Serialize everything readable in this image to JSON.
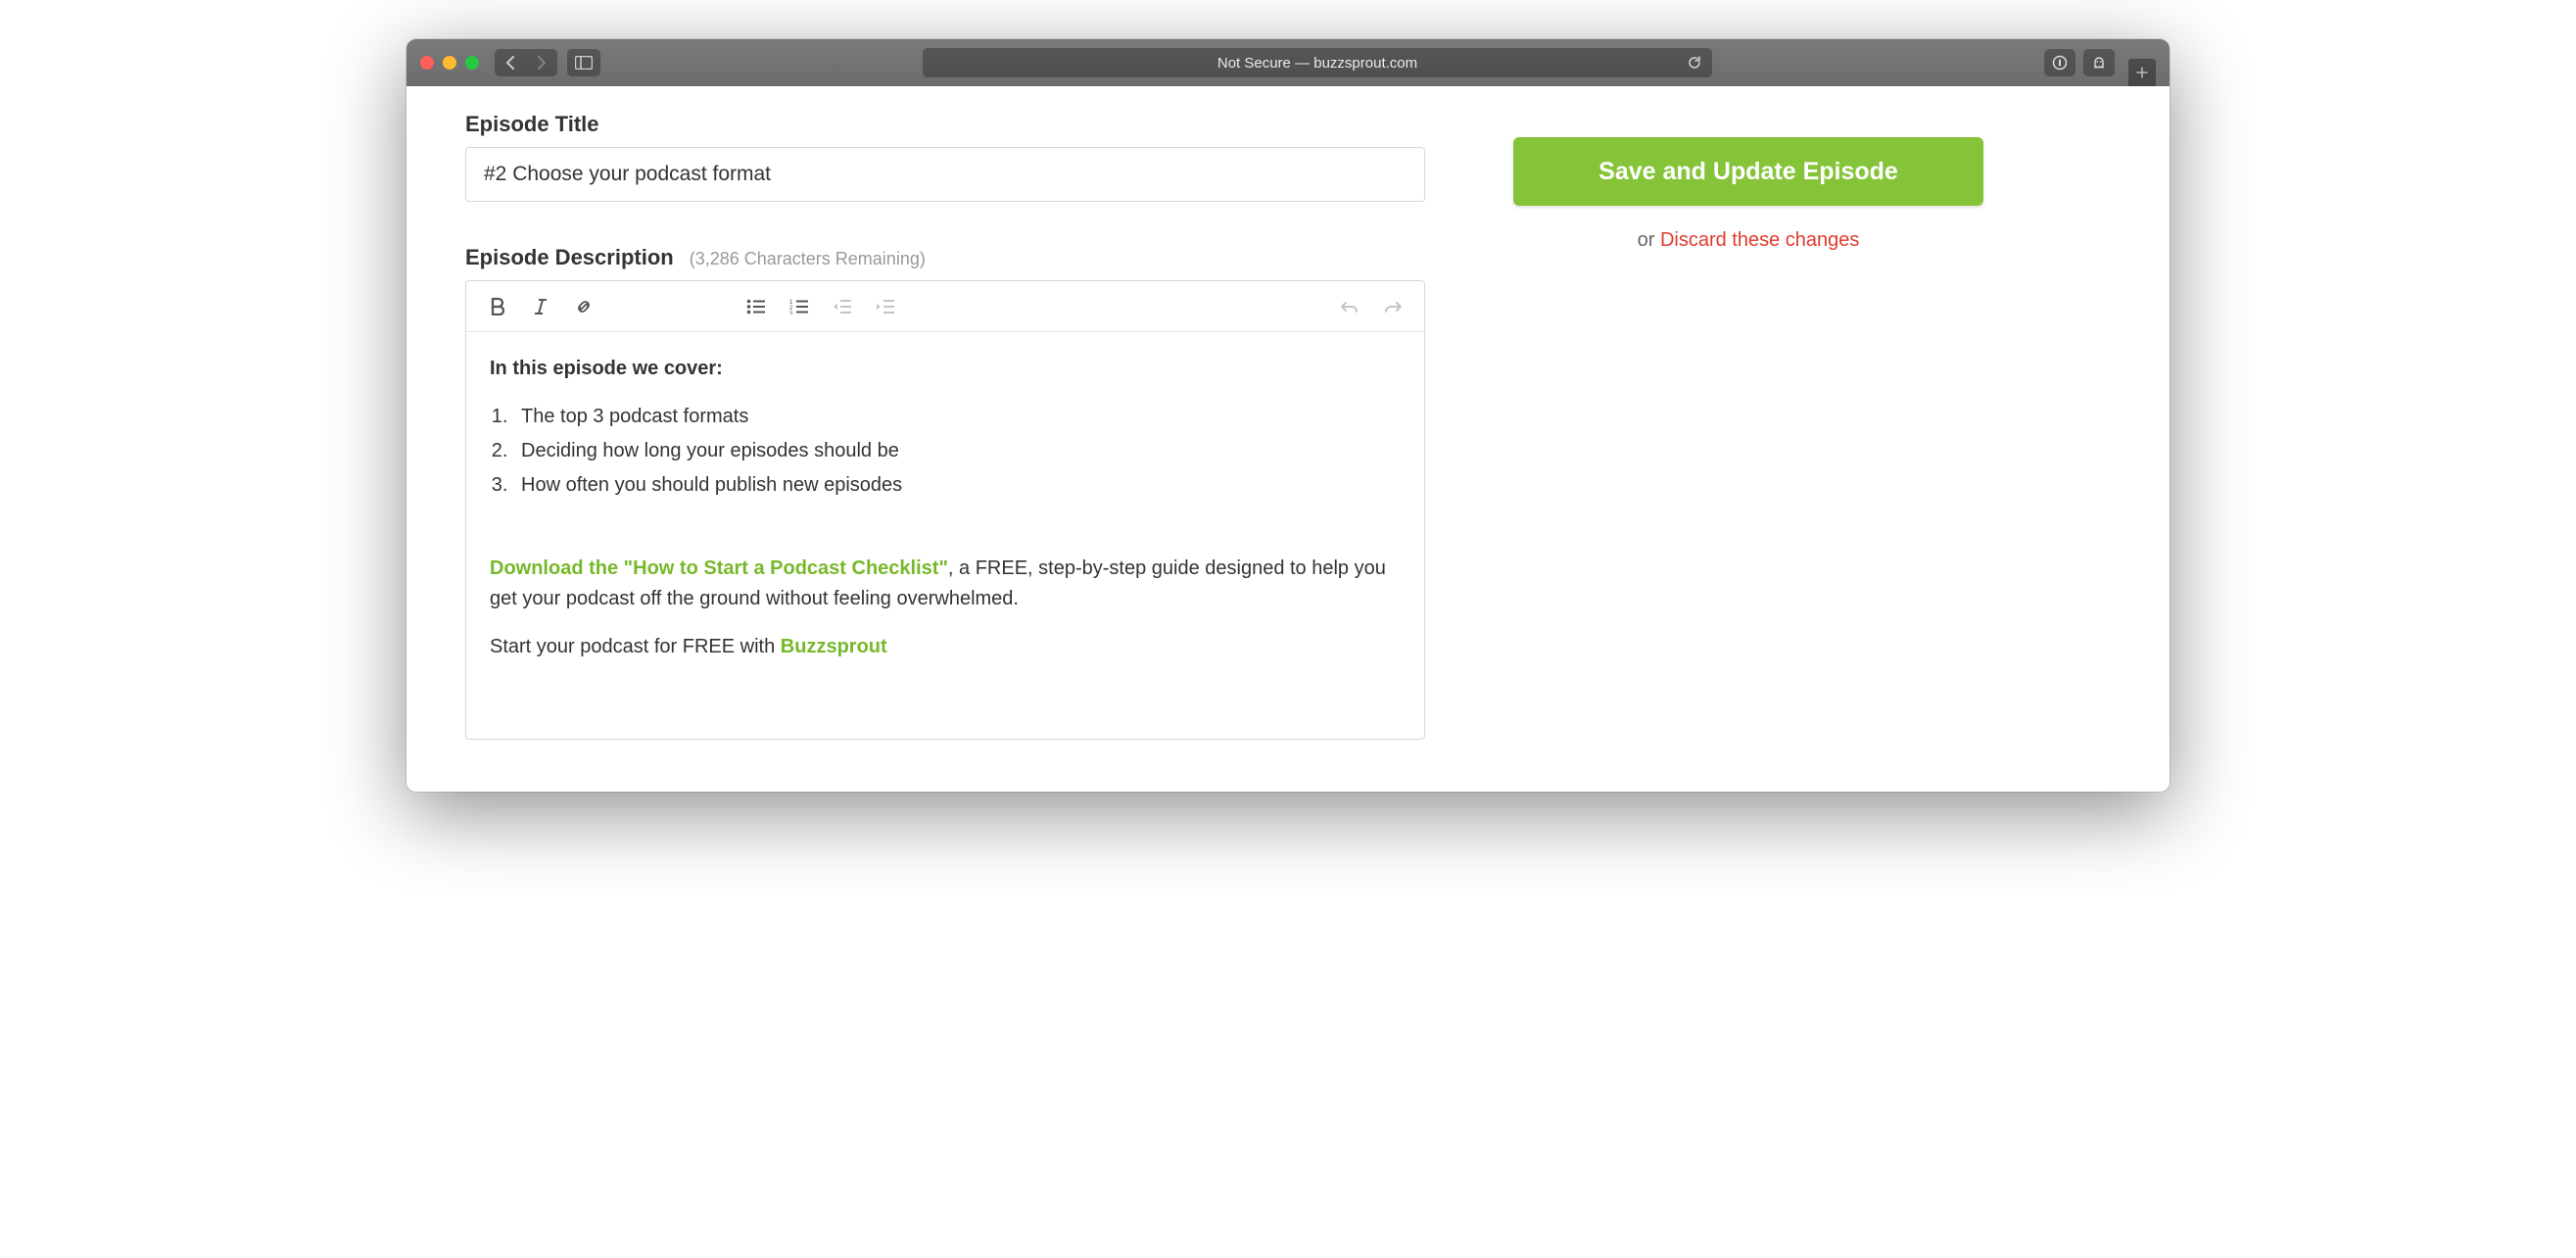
{
  "browser": {
    "address_text": "Not Secure — buzzsprout.com"
  },
  "form": {
    "title_label": "Episode Title",
    "title_value": "#2 Choose your podcast format",
    "description_label": "Episode Description",
    "chars_remaining": "(3,286 Characters Remaining)",
    "heading": "In this episode we cover:",
    "list": {
      "i1": "The top 3 podcast formats",
      "i2": "Deciding how long your episodes should be",
      "i3": "How often you should publish new episodes"
    },
    "link1_text": "Download the \"How to Start a Podcast Checklist\"",
    "p1_tail": ", a FREE, step-by-step guide designed to help you get your podcast off the ground without feeling overwhelmed.",
    "p2_pre": "Start your podcast for FREE with ",
    "link2_text": "Buzzsprout"
  },
  "sidebar": {
    "save_label": "Save and Update Episode",
    "or_text": "or ",
    "discard_text": "Discard these changes"
  }
}
